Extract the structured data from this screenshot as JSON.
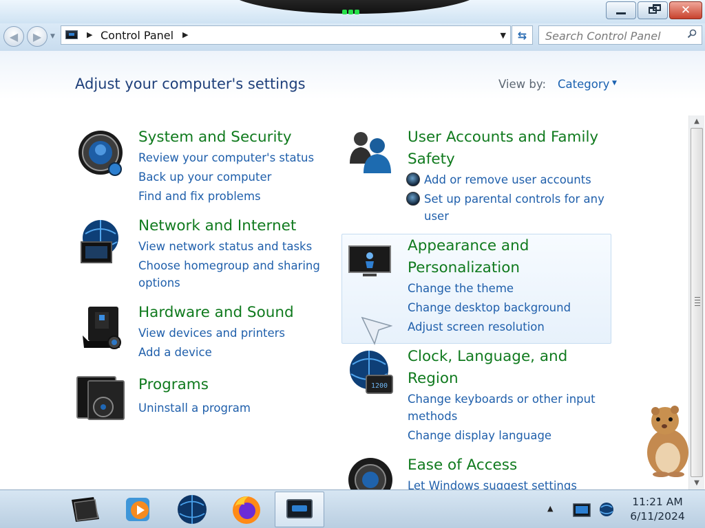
{
  "window": {
    "controls": [
      "minimize",
      "restore",
      "close"
    ]
  },
  "address_bar": {
    "crumbs": [
      "Control Panel"
    ],
    "search_placeholder": "Search Control Panel"
  },
  "header": {
    "title": "Adjust your computer's settings",
    "view_by_label": "View by:",
    "view_by_value": "Category"
  },
  "categories": [
    {
      "title": "System and Security",
      "icon": "shield-icon",
      "links": [
        "Review your computer's status",
        "Back up your computer",
        "Find and fix problems"
      ]
    },
    {
      "title": "Network and Internet",
      "icon": "globe-network-icon",
      "links": [
        "View network status and tasks",
        "Choose homegroup and sharing",
        "options"
      ]
    },
    {
      "title": "Hardware and Sound",
      "icon": "printer-speaker-icon",
      "links": [
        "View devices and printers",
        "Add a device"
      ]
    },
    {
      "title": "Programs",
      "icon": "programs-disc-icon",
      "links": [
        "Uninstall a program"
      ]
    },
    {
      "title_lines": [
        "User Accounts and Family",
        "Safety"
      ],
      "icon": "users-icon",
      "links": [
        "Add or remove user accounts",
        "Set up parental controls for any",
        "user"
      ]
    },
    {
      "title_lines": [
        "Appearance and",
        "Personalization"
      ],
      "icon": "monitor-icon",
      "links": [
        "Change the theme",
        "Change desktop background",
        "Adjust screen resolution"
      ]
    },
    {
      "title_lines": [
        "Clock, Language, and",
        "Region"
      ],
      "icon": "clock-globe-icon",
      "links": [
        "Change keyboards or other input",
        "methods",
        "Change display language"
      ]
    },
    {
      "title": "Ease of Access",
      "icon": "ease-of-access-icon",
      "links": [
        "Let Windows suggest settings"
      ]
    }
  ],
  "taskbar": {
    "apps": [
      "file-explorer-icon",
      "media-player-icon",
      "browser-globe-icon",
      "firefox-icon",
      "control-panel-icon"
    ],
    "time": "11:21 AM",
    "date": "6/11/2024"
  },
  "colors": {
    "link": "#1f5fab",
    "category_title": "#107a1e",
    "heading": "#1e3f7a"
  }
}
